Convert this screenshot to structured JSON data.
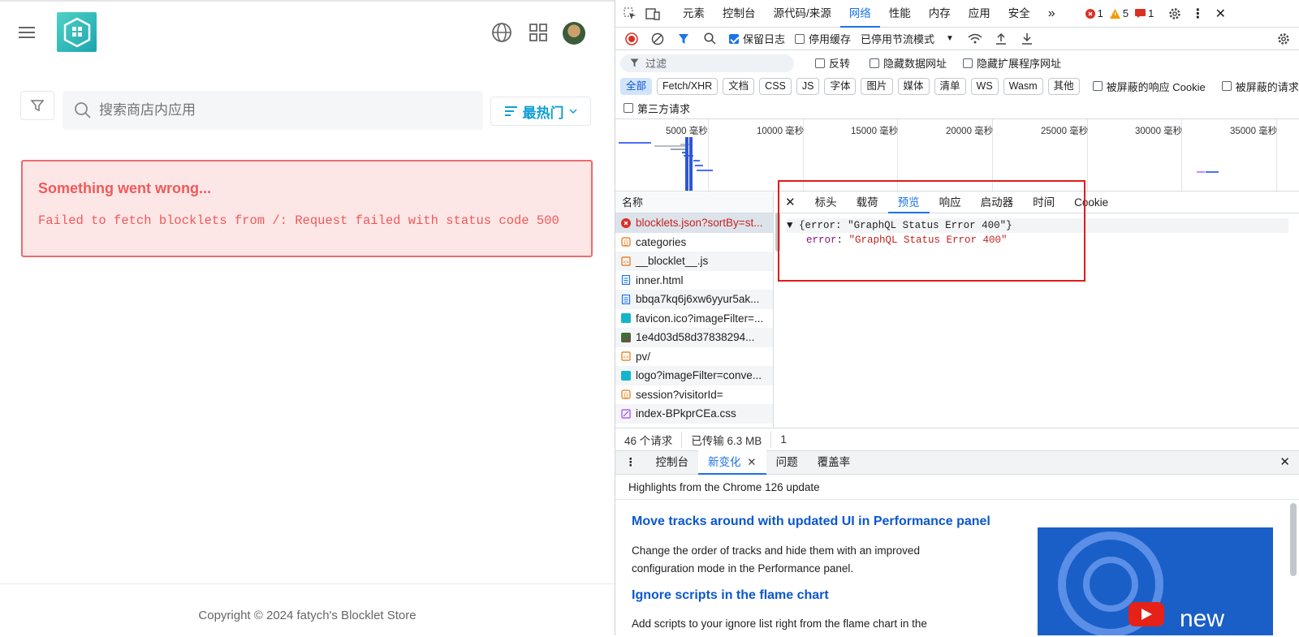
{
  "app": {
    "search_placeholder": "搜索商店内应用",
    "sort_label": "最热门",
    "error_title": "Something went wrong...",
    "error_message": "Failed to fetch blocklets from /: Request failed with status code 500",
    "footer": "Copyright © 2024 fatych's Blocklet Store",
    "accent_color": "#0f9ed4",
    "error_color": "#ef5a5a",
    "icons": [
      "menu-icon",
      "logo-icon",
      "globe-icon",
      "grid-icon",
      "avatar",
      "filter-icon",
      "search-icon",
      "sort-icon",
      "chevron-down-icon"
    ]
  },
  "devtools": {
    "tabs": [
      "元素",
      "控制台",
      "源代码/来源",
      "网络",
      "性能",
      "内存",
      "应用",
      "安全"
    ],
    "active_tab": "网络",
    "counts": {
      "errors": "1",
      "warnings": "5",
      "info": "1"
    },
    "toolbar": {
      "preserve_log": "保留日志",
      "disable_cache": "停用缓存",
      "throttle": "已停用节流模式"
    },
    "filter": {
      "placeholder": "过滤",
      "invert": "反转",
      "hide_data_urls": "隐藏数据网址",
      "hide_ext_urls": "隐藏扩展程序网址"
    },
    "types": [
      "全部",
      "Fetch/XHR",
      "文档",
      "CSS",
      "JS",
      "字体",
      "图片",
      "媒体",
      "清单",
      "WS",
      "Wasm",
      "其他"
    ],
    "blocked_cookies": "被屏蔽的响应 Cookie",
    "blocked_requests": "被屏蔽的请求",
    "third_party": "第三方请求",
    "timeline_ticks": [
      "5000 毫秒",
      "10000 毫秒",
      "15000 毫秒",
      "20000 毫秒",
      "25000 毫秒",
      "30000 毫秒",
      "35000 毫秒"
    ],
    "name_header": "名称",
    "requests": [
      {
        "name": "blocklets.json?sortBy=st...",
        "type": "error"
      },
      {
        "name": "categories",
        "type": "fetch"
      },
      {
        "name": "__blocklet__.js",
        "type": "script"
      },
      {
        "name": "inner.html",
        "type": "doc"
      },
      {
        "name": "bbqa7kq6j6xw6yyur5ak...",
        "type": "doc"
      },
      {
        "name": "favicon.ico?imageFilter=...",
        "type": "img"
      },
      {
        "name": "1e4d03d58d37838294...",
        "type": "img2"
      },
      {
        "name": "pv/",
        "type": "script"
      },
      {
        "name": "logo?imageFilter=conve...",
        "type": "img"
      },
      {
        "name": "session?visitorId=",
        "type": "fetch"
      },
      {
        "name": "index-BPkprCEa.css",
        "type": "css"
      }
    ],
    "preview_tabs": [
      "标头",
      "载荷",
      "预览",
      "响应",
      "启动器",
      "时间",
      "Cookie"
    ],
    "active_preview_tab": "预览",
    "preview": {
      "summary_key": "error",
      "summary_value": "\"GraphQL Status Error 400\"",
      "key": "error",
      "value": "\"GraphQL Status Error 400\""
    },
    "status": {
      "requests": "46 个请求",
      "transferred": "已传输 6.3 MB",
      "extra": "1"
    },
    "drawer_tabs": [
      "控制台",
      "新变化",
      "问题",
      "覆盖率"
    ],
    "active_drawer_tab": "新变化",
    "whats_new": {
      "header": "Highlights from the Chrome 126 update",
      "item1_title": "Move tracks around with updated UI in Performance panel",
      "item1_desc": "Change the order of tracks and hide them with an improved configuration mode in the Performance panel.",
      "item2_title": "Ignore scripts in the flame chart",
      "item2_desc": "Add scripts to your ignore list right from the flame chart in the Performance panel.",
      "video_label": "new"
    }
  }
}
